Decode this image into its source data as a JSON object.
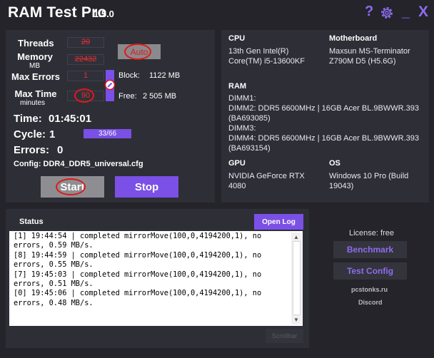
{
  "app": {
    "title": "RAM Test Pro",
    "version": "1.5.0"
  },
  "titlebar": {
    "help": "?",
    "minimize": "_",
    "close": "X"
  },
  "settings": {
    "threads": {
      "label": "Threads",
      "value": "20"
    },
    "memory": {
      "label": "Memory",
      "unit": "MB",
      "value": "22432"
    },
    "auto_label": "Auto",
    "max_errors": {
      "label": "Max Errors",
      "value": "1"
    },
    "max_time": {
      "label": "Max Time",
      "unit": "minutes",
      "value": "90"
    },
    "block": {
      "label": "Block:",
      "value": "1122 MB"
    },
    "free": {
      "label": "Free:",
      "value": "2 505 MB"
    }
  },
  "run": {
    "time_label": "Time:",
    "time_value": "01:45:01",
    "cycle_label": "Cycle:",
    "cycle_value": "1",
    "cycle_progress": "33/66",
    "errors_label": "Errors:",
    "errors_value": "0",
    "config_label": "Config:",
    "config_value": "DDR4_DDR5_universal.cfg"
  },
  "buttons": {
    "start": "Start",
    "stop": "Stop",
    "open_log": "Open Log",
    "benchmark": "Benchmark",
    "test_config": "Test Config"
  },
  "hardware": {
    "cpu": {
      "label": "CPU",
      "value": "13th Gen Intel(R)\nCore(TM) i5-13600KF"
    },
    "motherboard": {
      "label": "Motherboard",
      "value": "Maxsun MS-Terminator\nZ790M D5 (H5.6G)"
    },
    "ram": {
      "label": "RAM",
      "value": "DIMM1:\nDIMM2: DDR5 6600MHz | 16GB Acer BL.9BWWR.393\n(BA693085)\nDIMM3:\nDIMM4: DDR5 6600MHz | 16GB Acer BL.9BWWR.393\n(BA693154)"
    },
    "gpu": {
      "label": "GPU",
      "value": "NVIDIA GeForce RTX\n4080"
    },
    "os": {
      "label": "OS",
      "value": "Windows 10 Pro (Build\n19043)"
    }
  },
  "status": {
    "title": "Status",
    "log": "[1] 19:44:54 | completed mirrorMove(100,0,4194200,1), no errors, 0.59 MB/s.\n[8] 19:44:59 | completed mirrorMove(100,0,4194200,1), no errors, 0.55 MB/s.\n[7] 19:45:03 | completed mirrorMove(100,0,4194200,1), no errors, 0.51 MB/s.\n[0] 19:45:06 | completed mirrorMove(100,0,4194200,1), no errors, 0.48 MB/s.",
    "scrollbar_label": "Scrollbar"
  },
  "side": {
    "license": "License: free",
    "site": "pcstonks.ru",
    "discord": "Discord"
  },
  "colors": {
    "accent": "#7a50e6",
    "background": "#24242a",
    "panel": "#2e2e36",
    "annotation": "#e01818"
  }
}
